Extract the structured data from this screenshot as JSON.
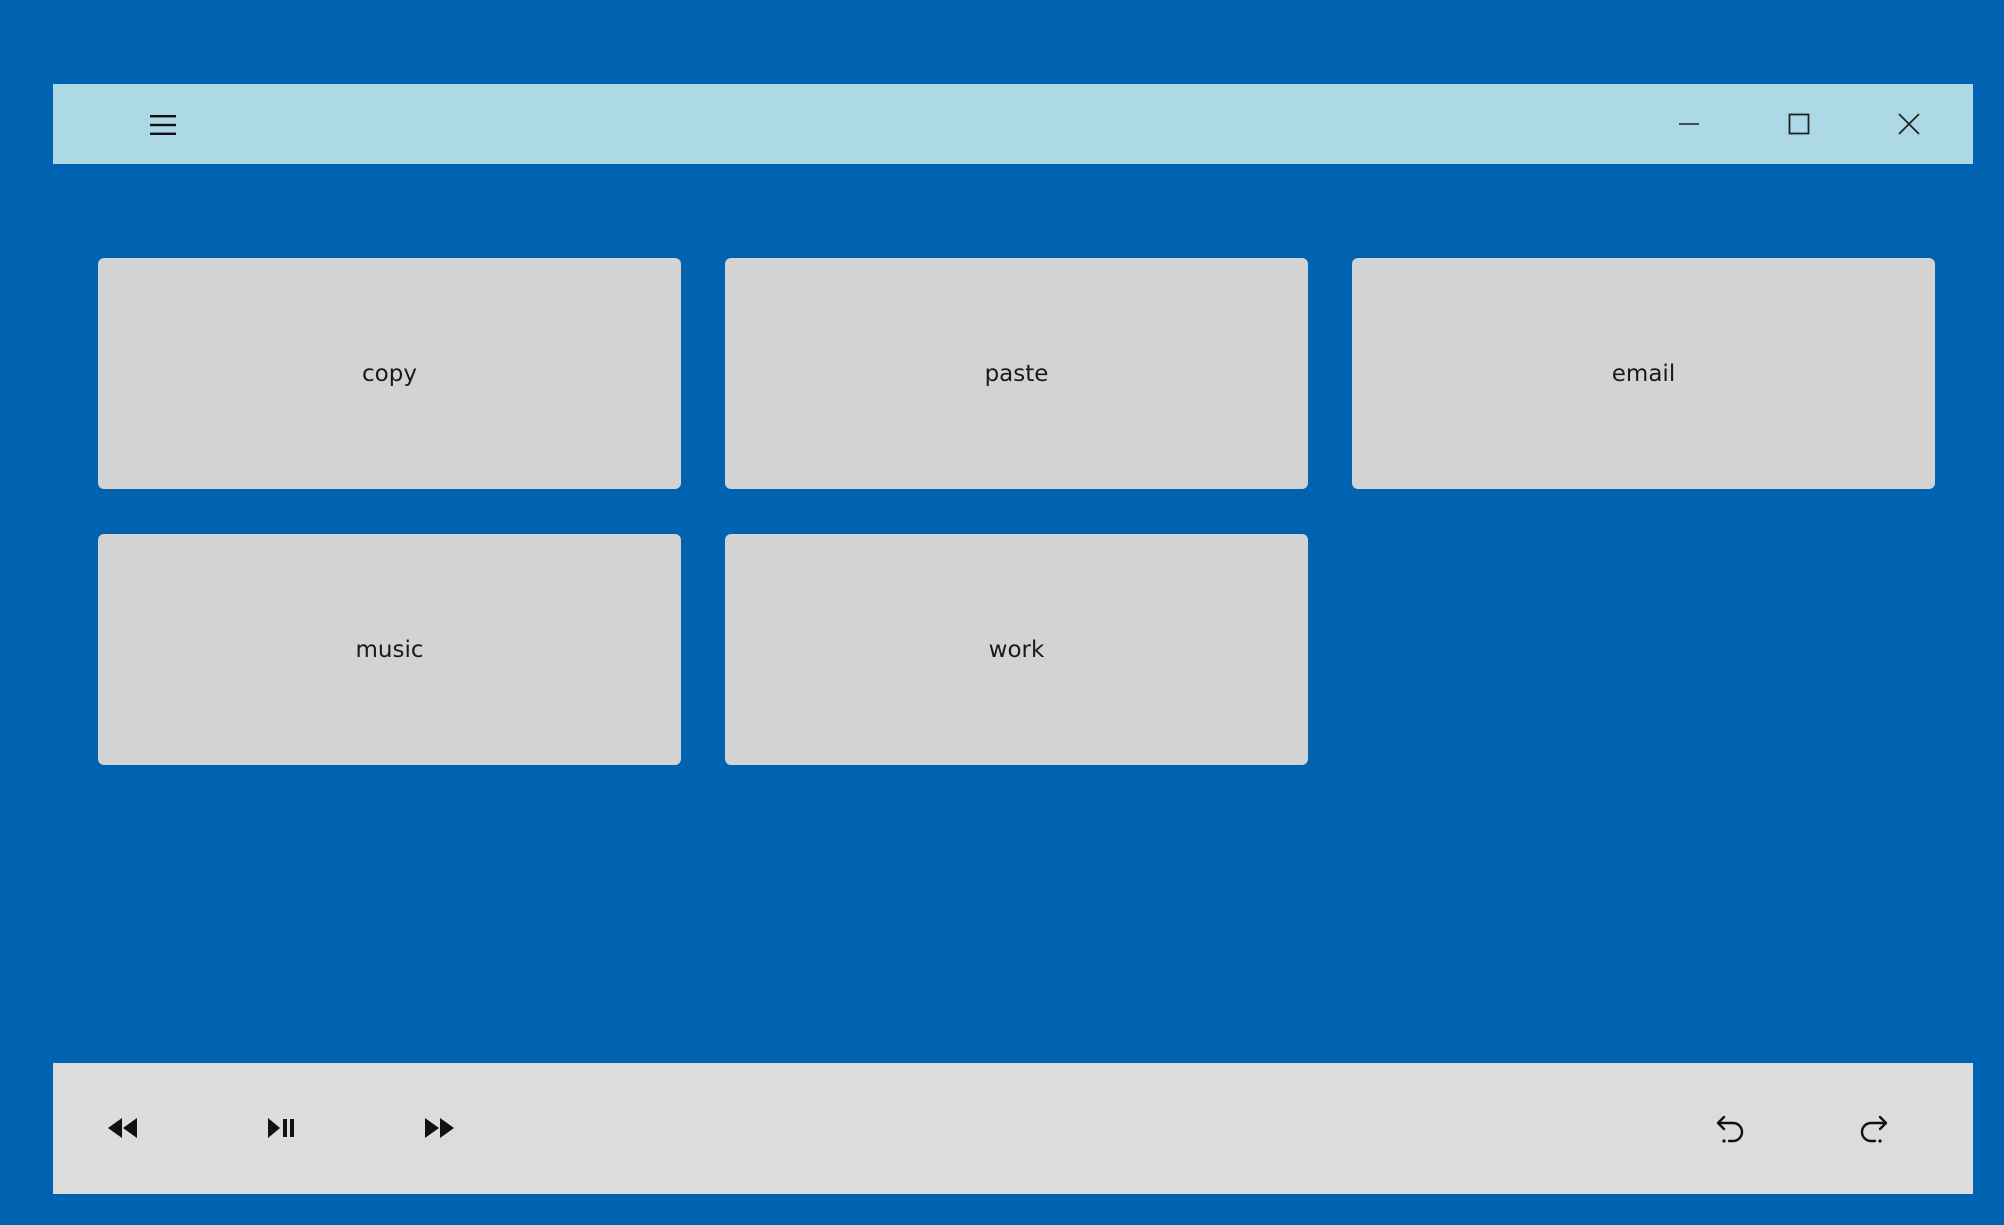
{
  "colors": {
    "background": "#0063b1",
    "titlebar": "#add8e6",
    "tile": "#d3d3d3",
    "bottombar": "#dcdcdc"
  },
  "titlebar": {
    "menu_icon": "hamburger-menu-icon",
    "minimize_icon": "minimize-icon",
    "maximize_icon": "maximize-icon",
    "close_icon": "close-icon"
  },
  "tiles": [
    {
      "label": "copy"
    },
    {
      "label": "paste"
    },
    {
      "label": "email"
    },
    {
      "label": "music"
    },
    {
      "label": "work"
    }
  ],
  "media_bar": {
    "buttons": [
      "rewind-icon",
      "play-pause-icon",
      "fast-forward-icon",
      "undo-icon",
      "redo-icon"
    ]
  }
}
